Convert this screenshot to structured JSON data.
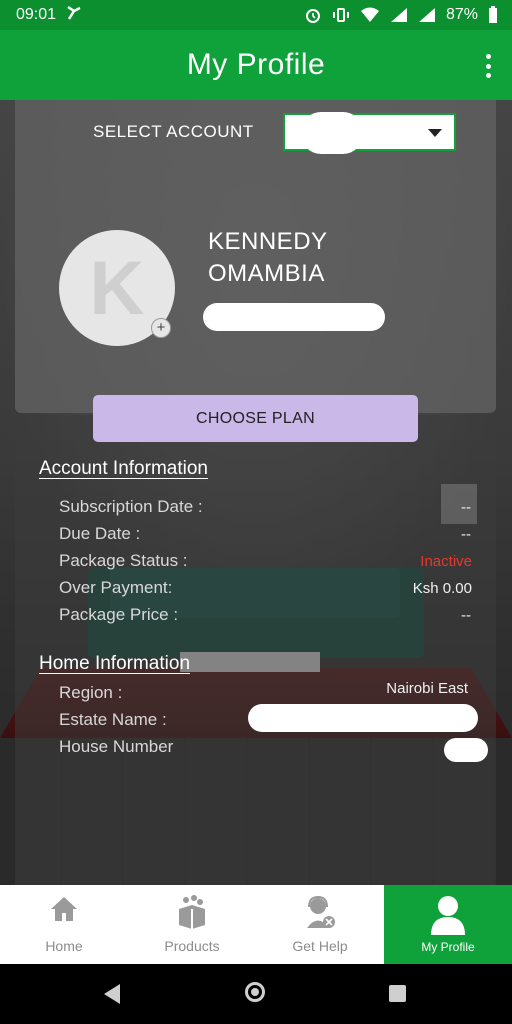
{
  "status_bar": {
    "time": "09:01",
    "battery": "87%"
  },
  "app_bar": {
    "title": "My Profile",
    "menu_icon": "more-vert-icon"
  },
  "account_select": {
    "label": "SELECT ACCOUNT",
    "value": ""
  },
  "profile": {
    "avatar_letter": "K",
    "first_name": "KENNEDY",
    "last_name": "OMAMBIA",
    "account_id": ""
  },
  "choose_plan": {
    "label": "CHOOSE PLAN"
  },
  "account_info": {
    "title": "Account Information",
    "rows": [
      {
        "label": "Subscription Date :",
        "value": "--"
      },
      {
        "label": "Due Date :",
        "value": "--"
      },
      {
        "label": "Package Status :",
        "value": "Inactive"
      },
      {
        "label": "Over Payment:",
        "value": "Ksh 0.00"
      },
      {
        "label": "Package Price :",
        "value": "--"
      }
    ]
  },
  "home_info": {
    "title": "Home Information",
    "rows": [
      {
        "label": "Region :",
        "value": "Nairobi East"
      },
      {
        "label": "Estate Name :",
        "value": ""
      },
      {
        "label": "House Number",
        "value": ""
      }
    ]
  },
  "bottom_nav": {
    "items": [
      {
        "label": "Home",
        "icon": "home-icon"
      },
      {
        "label": "Products",
        "icon": "products-box-icon"
      },
      {
        "label": "Get Help",
        "icon": "support-agent-icon"
      },
      {
        "label": "My Profile",
        "icon": "user-profile-icon"
      }
    ],
    "active": "My Profile"
  },
  "colors": {
    "primary_green": "#0fa23b",
    "status_green": "#0b8f2f",
    "plan_button": "#c9b8e8",
    "inactive_red": "#e23a2c"
  }
}
